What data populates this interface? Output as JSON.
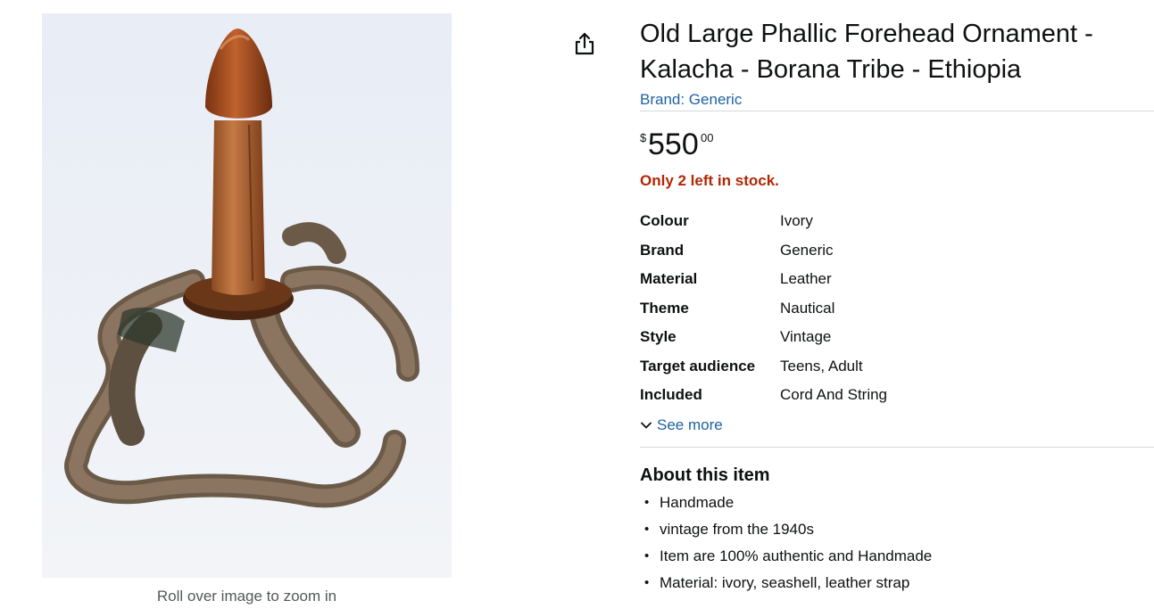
{
  "product": {
    "title": "Old Large Phallic Forehead Ornament - Kalacha - Borana Tribe - Ethiopia",
    "brand_link": "Brand: Generic",
    "price": {
      "symbol": "$",
      "whole": "550",
      "fraction": "00"
    },
    "stock": "Only 2 left in stock."
  },
  "image": {
    "zoom_hint": "Roll over image to zoom in"
  },
  "share": {
    "icon": "share-icon"
  },
  "specs": [
    {
      "key": "Colour",
      "value": "Ivory"
    },
    {
      "key": "Brand",
      "value": "Generic"
    },
    {
      "key": "Material",
      "value": "Leather"
    },
    {
      "key": "Theme",
      "value": "Nautical"
    },
    {
      "key": "Style",
      "value": "Vintage"
    },
    {
      "key": "Target audience",
      "value": "Teens, Adult"
    },
    {
      "key": "Included",
      "value": "Cord And String"
    }
  ],
  "see_more": {
    "label": "See more",
    "icon": "chevron-down-icon"
  },
  "about": {
    "heading": "About this item",
    "bullets": [
      "Handmade",
      "vintage from the 1940s",
      "Item are 100% authentic and Handmade",
      "Material: ivory, seashell, leather strap"
    ]
  },
  "colors": {
    "link": "#2162a1",
    "stock": "#b12704",
    "text": "#0f1111"
  }
}
